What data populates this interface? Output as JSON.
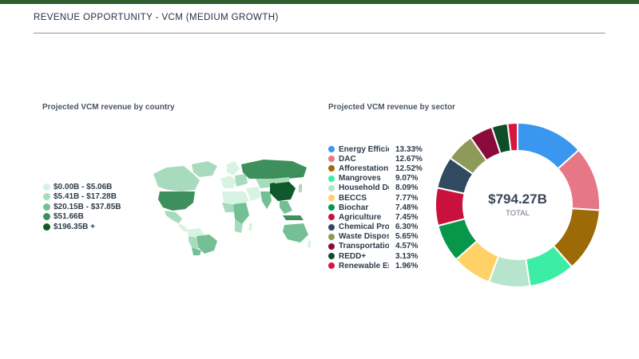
{
  "page": {
    "title": "REVENUE OPPORTUNITY - VCM (MEDIUM GROWTH)",
    "accent_color": "#2e5e2e"
  },
  "map_panel": {
    "title": "Projected VCM revenue by country",
    "legend": [
      {
        "label": "$0.00B - $5.06B",
        "color": "#d8f3e3"
      },
      {
        "label": "$5.41B - $17.28B",
        "color": "#a8dbbd"
      },
      {
        "label": "$20.15B - $37.85B",
        "color": "#74bf93"
      },
      {
        "label": "$51.66B",
        "color": "#3d8f5c"
      },
      {
        "label": "$196.35B +",
        "color": "#0f5a2c"
      }
    ]
  },
  "sector_panel": {
    "title": "Projected VCM revenue by sector",
    "total_value": "$794.27B",
    "total_label": "TOTAL"
  },
  "chart_data": [
    {
      "type": "map",
      "title": "Projected VCM revenue by country",
      "legend": [
        "$0.00B - $5.06B",
        "$5.41B - $17.28B",
        "$20.15B - $37.85B",
        "$51.66B",
        "$196.35B +"
      ]
    },
    {
      "type": "pie",
      "title": "Projected VCM revenue by sector",
      "center_value": "$794.27B",
      "center_label": "TOTAL",
      "slices": [
        {
          "label": "Energy Efficie",
          "value": 13.33,
          "pct_label": "13.33%",
          "color": "#3b96f0"
        },
        {
          "label": "DAC",
          "value": 12.67,
          "pct_label": "12.67%",
          "color": "#e57786"
        },
        {
          "label": "Afforestation",
          "value": 12.52,
          "pct_label": "12.52%",
          "color": "#9c6a06"
        },
        {
          "label": "Mangroves",
          "value": 9.07,
          "pct_label": "9.07%",
          "color": "#3ceea5"
        },
        {
          "label": "Household Dev",
          "value": 8.09,
          "pct_label": "8.09%",
          "color": "#b7e4cd"
        },
        {
          "label": "BECCS",
          "value": 7.77,
          "pct_label": "7.77%",
          "color": "#ffd166"
        },
        {
          "label": "Biochar",
          "value": 7.48,
          "pct_label": "7.48%",
          "color": "#07964a"
        },
        {
          "label": "Agriculture",
          "value": 7.45,
          "pct_label": "7.45%",
          "color": "#c9113e"
        },
        {
          "label": "Chemical Proc",
          "value": 6.3,
          "pct_label": "6.30%",
          "color": "#324a5f"
        },
        {
          "label": "Waste Disposa",
          "value": 5.65,
          "pct_label": "5.65%",
          "color": "#8d9a5a"
        },
        {
          "label": "Transportation",
          "value": 4.57,
          "pct_label": "4.57%",
          "color": "#8a0a3c"
        },
        {
          "label": "REDD+",
          "value": 3.13,
          "pct_label": "3.13%",
          "color": "#0e4d27"
        },
        {
          "label": "Renewable Ene",
          "value": 1.96,
          "pct_label": "1.96%",
          "color": "#d7153f"
        }
      ]
    }
  ]
}
